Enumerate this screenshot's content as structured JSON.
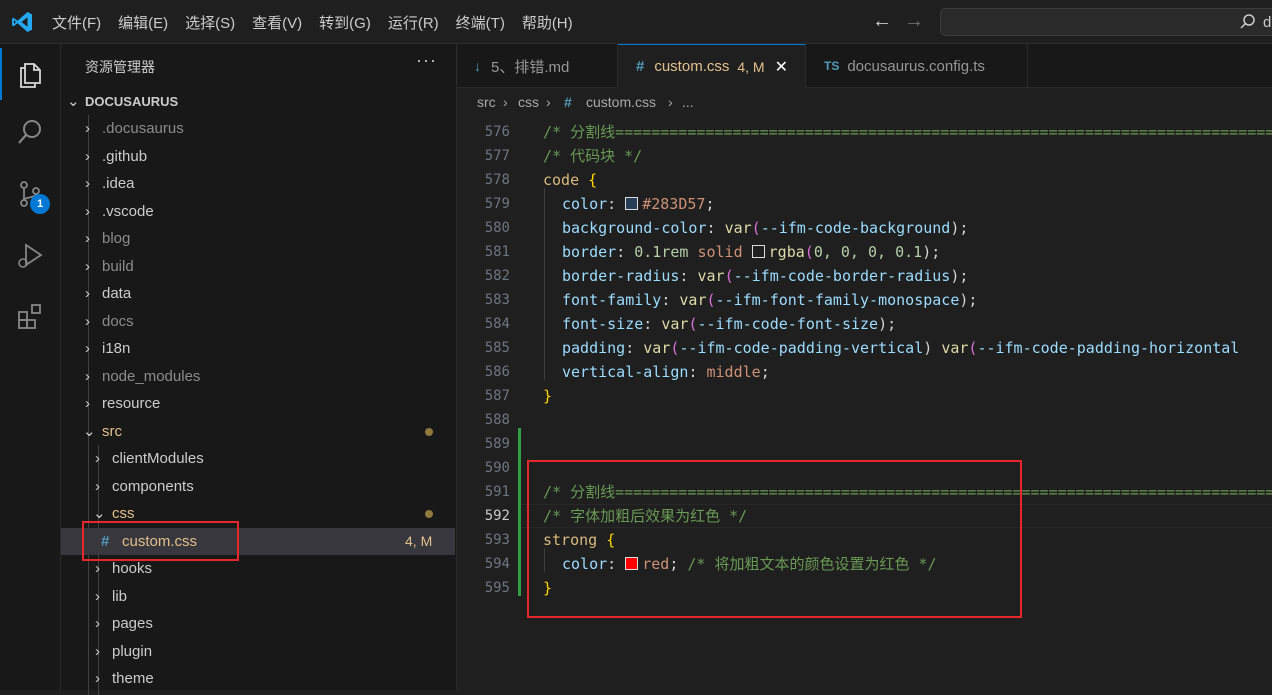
{
  "menu": [
    "文件(F)",
    "编辑(E)",
    "选择(S)",
    "查看(V)",
    "转到(G)",
    "运行(R)",
    "终端(T)",
    "帮助(H)"
  ],
  "search": {
    "text": "d"
  },
  "activity": {
    "scm_badge": "1"
  },
  "sidebar": {
    "title": "资源管理器",
    "more": "···",
    "root": "DOCUSAURUS",
    "items": [
      {
        "label": ".docusaurus"
      },
      {
        "label": ".github"
      },
      {
        "label": ".idea"
      },
      {
        "label": ".vscode"
      },
      {
        "label": "blog"
      },
      {
        "label": "build"
      },
      {
        "label": "data"
      },
      {
        "label": "docs"
      },
      {
        "label": "i18n"
      },
      {
        "label": "node_modules"
      },
      {
        "label": "resource"
      },
      {
        "label": "src"
      },
      {
        "label": "clientModules"
      },
      {
        "label": "components"
      },
      {
        "label": "css"
      },
      {
        "label": "custom.css",
        "status": "4, M"
      },
      {
        "label": "hooks"
      },
      {
        "label": "lib"
      },
      {
        "label": "pages"
      },
      {
        "label": "plugin"
      },
      {
        "label": "theme"
      }
    ]
  },
  "tabs": [
    {
      "label": "5、排错.md",
      "icon": "↓"
    },
    {
      "label": "custom.css",
      "icon": "#",
      "status": "4, M",
      "close": "✕"
    },
    {
      "label": "docusaurus.config.ts",
      "icon": "TS"
    }
  ],
  "breadcrumb": {
    "a": "src",
    "b": "css",
    "hash": "#",
    "c": "custom.css",
    "d": "..."
  },
  "colors": {
    "accent": "#0078d4",
    "modified": "#e2c08d",
    "added": "#2ea043",
    "highlight_box": "#e5282a"
  },
  "editor": {
    "current_line": "592",
    "lines": [
      {
        "n": "576",
        "t1": "/* 分割线=============================================================================="
      },
      {
        "n": "577",
        "t1": "/* 代码块 */"
      },
      {
        "n": "578",
        "t1": "code",
        "t2": " {"
      },
      {
        "n": "579",
        "t1": "color",
        "t2": ": ",
        "t3": "#283D57",
        "t4": ";"
      },
      {
        "n": "580",
        "t1": "background-color",
        "t2": ": ",
        "t3": "var",
        "t4": "(",
        "t5": "--ifm-code-background",
        "t6": ");"
      },
      {
        "n": "581",
        "t1": "border",
        "t2": ": ",
        "t3": "0.1rem",
        "t4": " solid ",
        "t5": "rgba",
        "t6": "(",
        "t7": "0, 0, 0, 0.1",
        "t8": ");"
      },
      {
        "n": "582",
        "t1": "border-radius",
        "t2": ": ",
        "t3": "var",
        "t4": "(",
        "t5": "--ifm-code-border-radius",
        "t6": ");"
      },
      {
        "n": "583",
        "t1": "font-family",
        "t2": ": ",
        "t3": "var",
        "t4": "(",
        "t5": "--ifm-font-family-monospace",
        "t6": ");"
      },
      {
        "n": "584",
        "t1": "font-size",
        "t2": ": ",
        "t3": "var",
        "t4": "(",
        "t5": "--ifm-code-font-size",
        "t6": ");"
      },
      {
        "n": "585",
        "t1": "padding",
        "t2": ": ",
        "t3": "var",
        "t4": "(",
        "t5": "--ifm-code-padding-vertical",
        "t6": ") ",
        "t7": "var",
        "t8": "(",
        "t9": "--ifm-code-padding-horizontal"
      },
      {
        "n": "586",
        "t1": "vertical-align",
        "t2": ": ",
        "t3": "middle",
        "t4": ";"
      },
      {
        "n": "587",
        "t1": "}"
      },
      {
        "n": "588"
      },
      {
        "n": "589"
      },
      {
        "n": "590"
      },
      {
        "n": "591",
        "t1": "/* 分割线=============================================================================="
      },
      {
        "n": "592",
        "t1": "/* 字体加粗后效果为红色 */"
      },
      {
        "n": "593",
        "t1": "strong",
        "t2": " {"
      },
      {
        "n": "594",
        "t1": "color",
        "t2": ": ",
        "t3": "red",
        "t4": "; ",
        "t5": "/* 将加粗文本的颜色设置为红色 */"
      },
      {
        "n": "595",
        "t1": "}"
      }
    ]
  }
}
